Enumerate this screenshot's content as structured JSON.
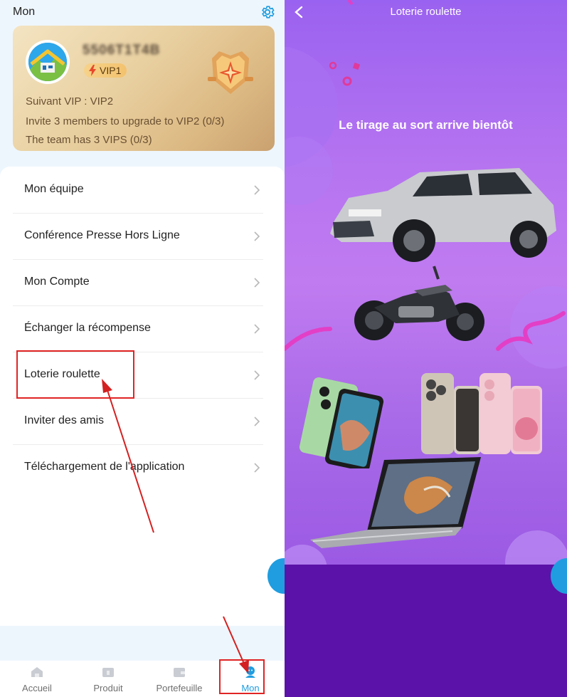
{
  "left": {
    "header": {
      "title": "Mon"
    },
    "vip_card": {
      "user_id": "5506T1T4B",
      "vip_level": "VIP1",
      "next_vip": "Suivant VIP : VIP2",
      "invite_line": "Invite 3 members to upgrade to VIP2 (0/3)",
      "team_line": "The team has 3 VIPS (0/3)"
    },
    "menu": {
      "items": [
        {
          "label": "Mon équipe"
        },
        {
          "label": "Conférence Presse Hors Ligne"
        },
        {
          "label": "Mon Compte"
        },
        {
          "label": "Échanger la récompense"
        },
        {
          "label": "Loterie roulette"
        },
        {
          "label": "Inviter des amis"
        },
        {
          "label": "Téléchargement de l'application"
        }
      ]
    },
    "tabbar": {
      "tabs": [
        {
          "label": "Accueil",
          "icon": "home-icon"
        },
        {
          "label": "Produit",
          "icon": "product-icon"
        },
        {
          "label": "Portefeuille",
          "icon": "wallet-icon"
        },
        {
          "label": "Mon",
          "icon": "profile-icon",
          "active": true
        }
      ]
    }
  },
  "right": {
    "header": {
      "title": "Loterie roulette"
    },
    "promo": {
      "heading": "Le tirage au sort arrive bientôt",
      "prizes": [
        "car",
        "motorcycle",
        "smartphone",
        "iphones",
        "laptop"
      ]
    }
  },
  "colors": {
    "accent": "#1f9de0",
    "annotation_red": "#e02424",
    "promo_purple": "#a86ae8",
    "bottom_purple": "#5b12a8"
  }
}
